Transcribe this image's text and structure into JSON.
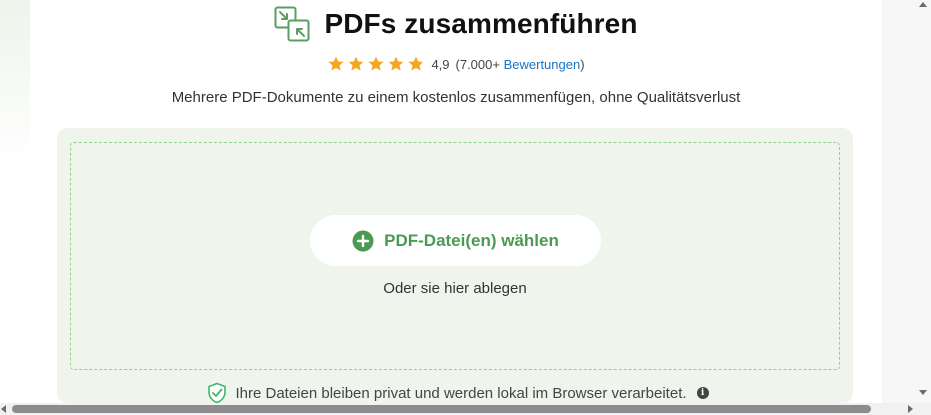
{
  "header": {
    "title": "PDFs zusammenführen",
    "icon": "merge-pdf-icon"
  },
  "rating": {
    "stars": 4.9,
    "score_text": "4,9",
    "count_open": "(7.000+",
    "link_label": "Bewertungen",
    "count_close": ")"
  },
  "subtitle": "Mehrere PDF-Dokumente zu einem kostenlos zusammenfügen, ohne Qualitätsverlust",
  "dropzone": {
    "button_label": "PDF-Datei(en) wählen",
    "hint": "Oder sie hier ablegen"
  },
  "privacy": {
    "text": "Ihre Dateien bleiben privat und werden lokal im Browser verarbeitet.",
    "info_glyph": "i"
  },
  "colors": {
    "accent_green": "#4a9a54",
    "panel_bg": "#eff5ed",
    "dash_border": "#8fd48a",
    "star": "#f5a623",
    "link": "#1a73c8"
  }
}
